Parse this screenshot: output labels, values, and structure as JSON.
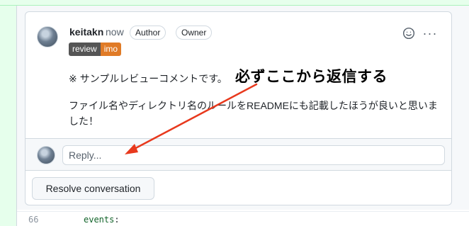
{
  "comment": {
    "author": "keitakn",
    "time": "now",
    "labels": [
      "Author",
      "Owner"
    ],
    "badge": {
      "left": "review",
      "right": "imo"
    },
    "body_line1": "※ サンプルレビューコメントです。",
    "body_line2": "ファイル名やディレクトリ名のルールをREADMEにも記載したほうが良いと思いました！",
    "actions": {
      "reaction_icon": "smiley-icon",
      "more_icon": "kebab-horizontal-icon",
      "more_glyph": "···"
    }
  },
  "annotation": {
    "text": "必ずここから返信する",
    "arrow_color": "#e8391d"
  },
  "reply": {
    "placeholder": "Reply..."
  },
  "resolve": {
    "label": "Resolve conversation"
  },
  "code": {
    "line_number": "66",
    "text": "events",
    "colon": ":"
  }
}
